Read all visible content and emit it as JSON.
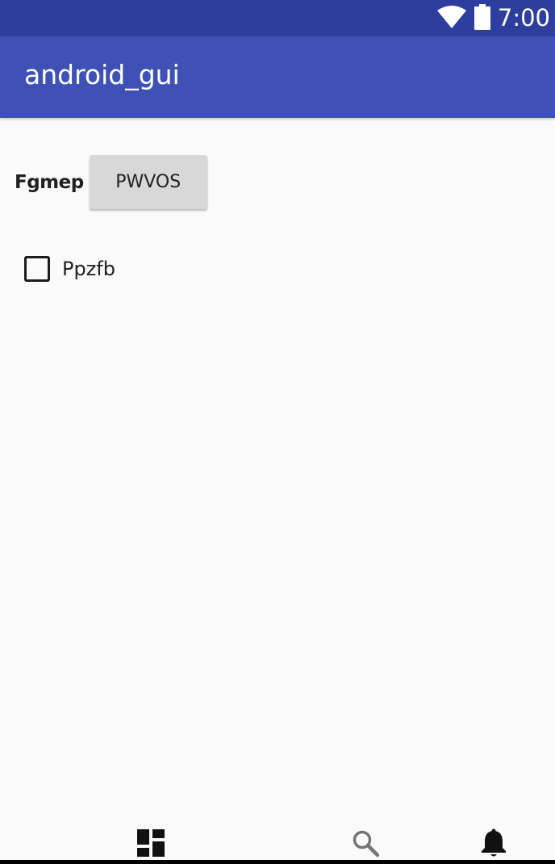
{
  "status_bar": {
    "time": "7:00",
    "wifi_icon": "wifi-icon",
    "battery_icon": "battery-icon",
    "background_color": "#2e3e9e"
  },
  "app_bar": {
    "title": "android_gui",
    "background_color": "#3f51b5"
  },
  "content": {
    "label": "Fgmep",
    "button_label": "PWVOS",
    "checkbox_label": "Ppzfb",
    "checkbox_checked": false
  },
  "bottom_nav": {
    "items": [
      {
        "icon": "dashboard-icon"
      },
      {
        "icon": "search-icon"
      },
      {
        "icon": "notifications-icon"
      }
    ]
  }
}
